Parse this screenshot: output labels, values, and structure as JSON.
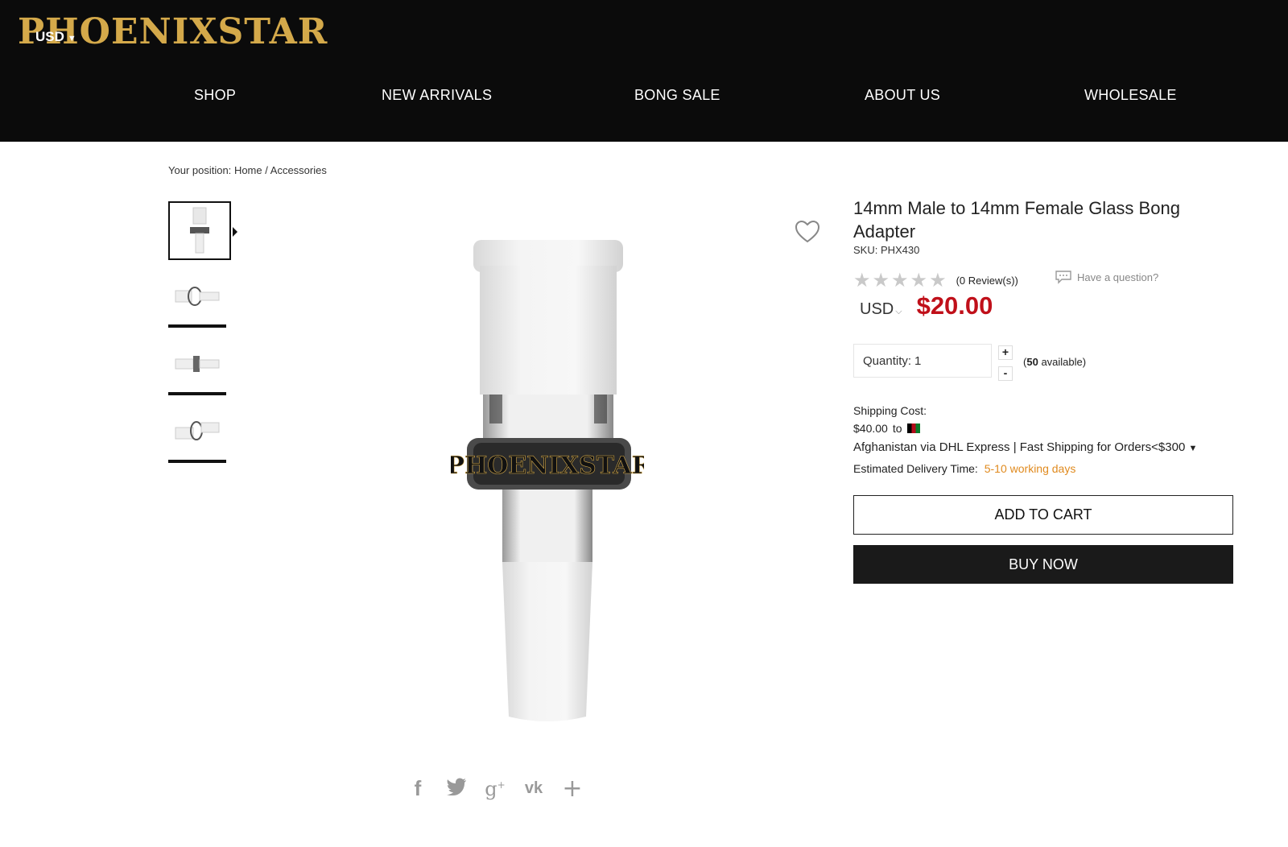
{
  "header": {
    "logo": "PHOENIXSTAR",
    "currency": "USD",
    "nav": [
      "SHOP",
      "NEW ARRIVALS",
      "BONG SALE",
      "ABOUT US",
      "WHOLESALE"
    ]
  },
  "breadcrumb": {
    "prefix": "Your position:",
    "home": "Home",
    "separator": "/",
    "current": "Accessories"
  },
  "product": {
    "title": "14mm Male to 14mm Female Glass Bong Adapter",
    "sku": "SKU: PHX430",
    "rating_stars": 0,
    "reviews": "(0 Review(s))",
    "question": "Have a question?",
    "currency": "USD",
    "price": "$20.00",
    "image_logo_text": "PHOENIXSTAR"
  },
  "quantity": {
    "label": "Quantity:",
    "value": "1",
    "plus": "+",
    "minus": "-",
    "available_count": "50",
    "available_text": "available)"
  },
  "shipping": {
    "label": "Shipping Cost:",
    "cost": "$40.00",
    "to": "to",
    "method": "Afghanistan via DHL Express | Fast Shipping for Orders<$300",
    "delivery_label": "Estimated Delivery Time:",
    "delivery_days": "5-10 working days"
  },
  "actions": {
    "add_to_cart": "ADD TO CART",
    "buy_now": "BUY NOW"
  },
  "share": [
    "facebook",
    "twitter",
    "google-plus",
    "vk",
    "more"
  ],
  "colors": {
    "header_bg": "#0b0b0b",
    "logo": "#d4a94a",
    "price": "#c0101a",
    "delivery": "#e08a1e"
  }
}
